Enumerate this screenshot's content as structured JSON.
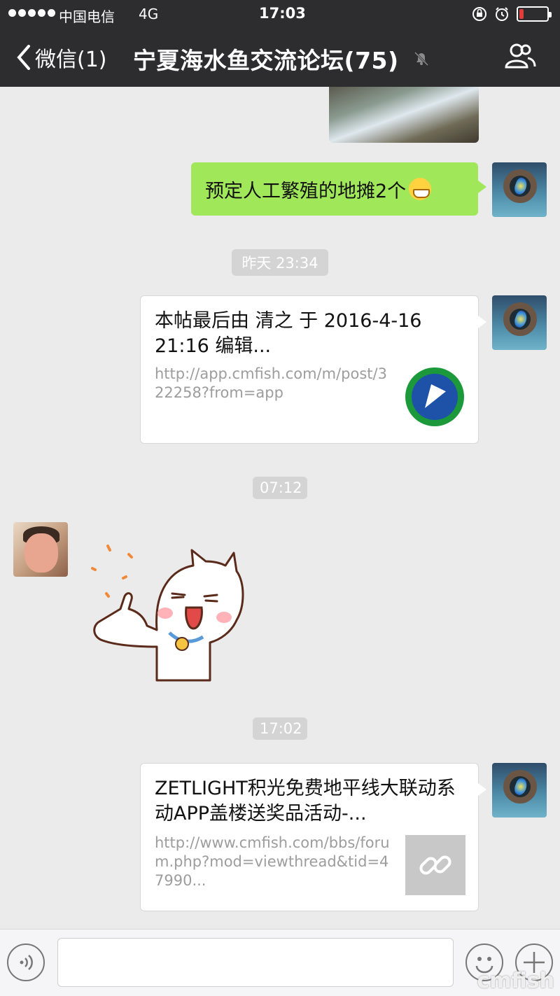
{
  "status_bar": {
    "carrier": "中国电信",
    "network": "4G",
    "time": "17:03",
    "battery_level": 0.15,
    "battery_color": "#e23c3c",
    "icons": [
      "orientation-lock-icon",
      "alarm-icon",
      "battery-icon"
    ]
  },
  "nav": {
    "back_label": "微信(1)",
    "title": "宁夏海水鱼交流论坛(75)",
    "mute_icon": "mute-bell-icon",
    "members_icon": "group-members-icon"
  },
  "messages": {
    "sent_text": "预定人工繁殖的地摊2个",
    "time_1": "昨天 23:34",
    "link_1": {
      "title": "本帖最后由 清之 于 2016-4-16 21:16 编辑...",
      "url": "http://app.cmfish.com/m/post/322258?from=app"
    },
    "time_2": "07:12",
    "time_3": "17:02",
    "link_2": {
      "title": "ZETLIGHT积光免费地平线大联动系动APP盖楼送奖品活动-...",
      "url": "http://www.cmfish.com/bbs/forum.php?mod=viewthread&tid=47990..."
    }
  },
  "input_bar": {
    "text_value": "",
    "watermark": "cmfish"
  },
  "colors": {
    "topbar": "#2d2d30",
    "bubble_green": "#a0e75a",
    "chat_bg": "#ebebeb"
  }
}
